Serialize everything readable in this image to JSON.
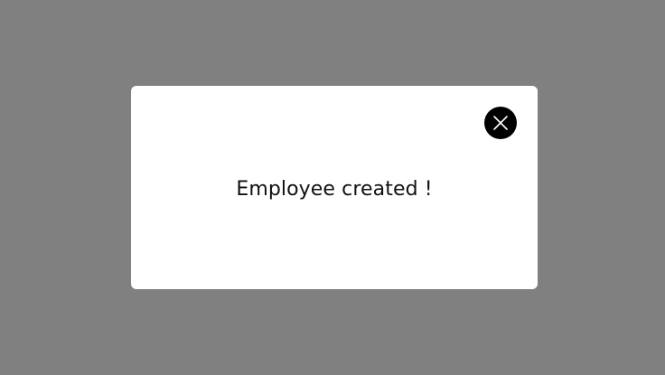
{
  "modal": {
    "message": "Employee created !",
    "close_icon": "close-icon"
  },
  "colors": {
    "overlay": "#808080",
    "modal_background": "#ffffff",
    "close_button": "#000000",
    "text": "#111111"
  }
}
